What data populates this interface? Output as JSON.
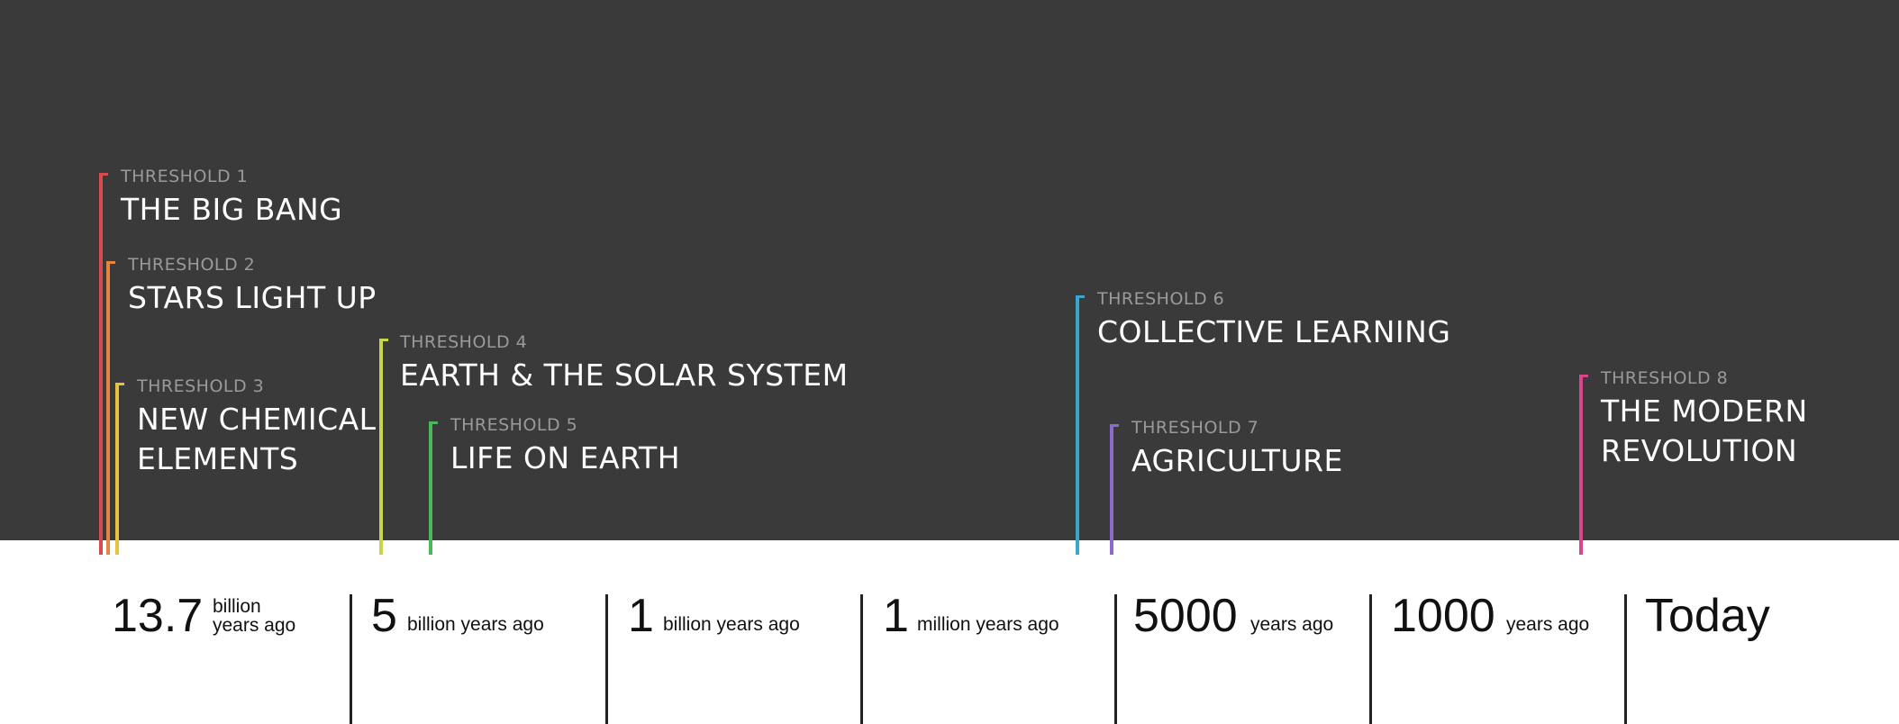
{
  "thresholds": [
    {
      "number": "THRESHOLD 1",
      "title": "THE BIG BANG",
      "color": "#d94a4a"
    },
    {
      "number": "THRESHOLD 2",
      "title": "STARS LIGHT UP",
      "color": "#e8843c"
    },
    {
      "number": "THRESHOLD 3",
      "title": "NEW CHEMICAL ELEMENTS",
      "title_lines": [
        "NEW CHEMICAL",
        "ELEMENTS"
      ],
      "color": "#e8c23c"
    },
    {
      "number": "THRESHOLD 4",
      "title": "EARTH & THE SOLAR SYSTEM",
      "color": "#c8d44a"
    },
    {
      "number": "THRESHOLD 5",
      "title": "LIFE ON EARTH",
      "color": "#4ab85a"
    },
    {
      "number": "THRESHOLD 6",
      "title": "COLLECTIVE LEARNING",
      "color": "#3aa6cc"
    },
    {
      "number": "THRESHOLD 7",
      "title": "AGRICULTURE",
      "color": "#8a6ccc"
    },
    {
      "number": "THRESHOLD 8",
      "title": "THE MODERN REVOLUTION",
      "title_lines": [
        "THE MODERN",
        "REVOLUTION"
      ],
      "color": "#d9468c"
    }
  ],
  "scale": [
    {
      "big": "13.7",
      "small_lines": [
        "billion",
        "years ago"
      ]
    },
    {
      "big": "5",
      "small": "billion years ago"
    },
    {
      "big": "1",
      "small": "billion years ago"
    },
    {
      "big": "1",
      "small": "million years ago"
    },
    {
      "big": "5000",
      "small": "years ago"
    },
    {
      "big": "1000",
      "small": "years ago"
    },
    {
      "big": "Today",
      "small": ""
    }
  ]
}
